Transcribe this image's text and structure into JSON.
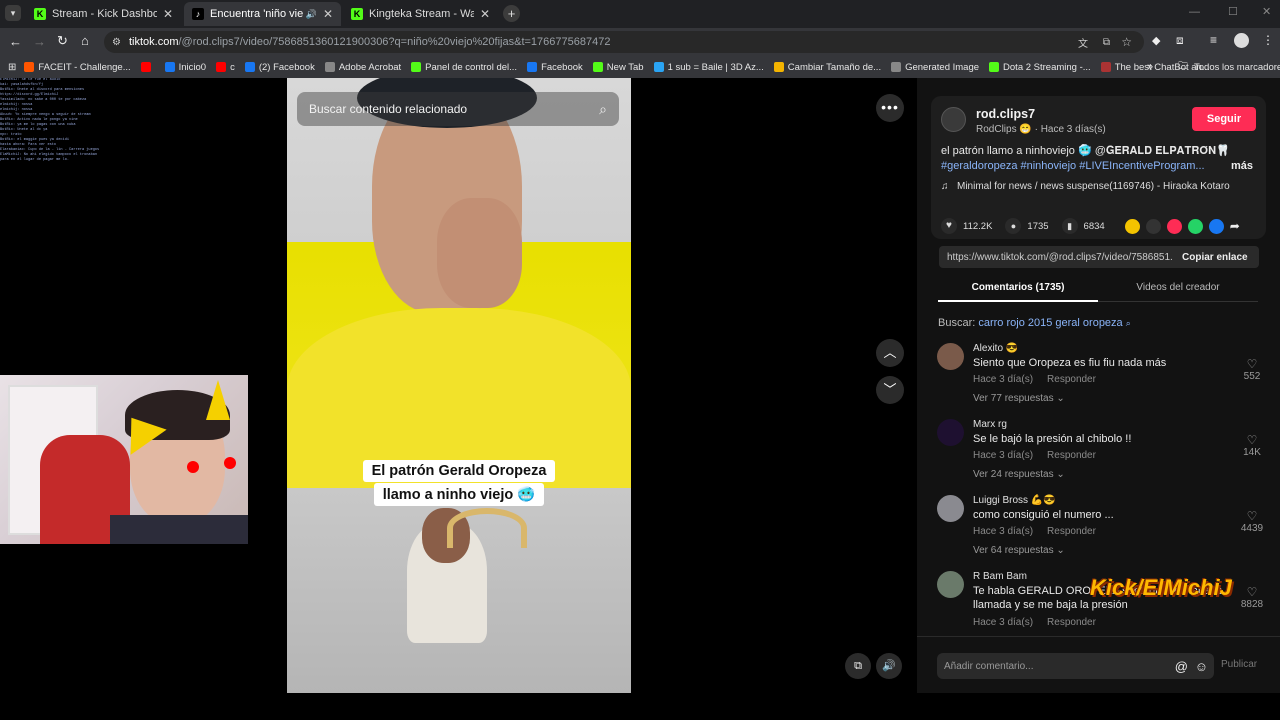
{
  "tabs": [
    {
      "title": "Stream - Kick Dashboard",
      "favicon": "kick-icon"
    },
    {
      "title": "Encuentra 'niño viejo fijas'",
      "favicon": "tiktok-icon",
      "active": true
    },
    {
      "title": "Kingteka Stream - Watch Live o",
      "favicon": "kick-icon"
    }
  ],
  "toolbar": {
    "url_host": "tiktok.com",
    "url_path": "/@rod.clips7/video/7586851360121900306?q=niño%20viejo%20fijas&t=1766775687472"
  },
  "bookmarks": [
    {
      "label": "FACEIT - Challenge...",
      "color": "#ff5500"
    },
    {
      "label": "",
      "color": "#ff0000"
    },
    {
      "label": "Inicio0",
      "color": "#1877f2"
    },
    {
      "label": "c",
      "color": "#ff0000"
    },
    {
      "label": "(2) Facebook",
      "color": "#1877f2"
    },
    {
      "label": "Adobe Acrobat",
      "color": "#888888"
    },
    {
      "label": "Panel de control del...",
      "color": "#53fc18"
    },
    {
      "label": "Facebook",
      "color": "#1877f2"
    },
    {
      "label": "New Tab",
      "color": "#53fc18"
    },
    {
      "label": "1 sub = Baile | 3D Az...",
      "color": "#2aa4f4"
    },
    {
      "label": "Cambiar Tamaño de...",
      "color": "#f4b400"
    },
    {
      "label": "Generated Image",
      "color": "#888888"
    },
    {
      "label": "Dota 2 Streaming -...",
      "color": "#53fc18"
    },
    {
      "label": "The best ChatBot an...",
      "color": "#aa3333"
    }
  ],
  "bookmarks_more": "»",
  "all_bookmarks": "Todos los marcadores",
  "video": {
    "search_placeholder": "Buscar contenido relacionado",
    "caption_line1": "El patrón Gerald Oropeza",
    "caption_line2": "llamo a ninho viejo 🥶"
  },
  "stream_watermark": "Kick/ElMichiJ",
  "chat_overlay": [
    "ElMichiJ: Se te fue el audio",
    "kai: yasalahdsfkn/fj",
    "BotRix: Únete al discord para mensiones",
    "https://discord.gg/ElmichiJ",
    "Yassimilado: no sabe a 000 te por cabeza",
    "elmichij: nossa",
    "elmichij: nossa",
    "Akuuh: Yo siempre vengo a seguir de stream",
    "BotRix: Activo nada le pongo ya vine",
    "BotRix: ya me lo pagas con una cuba",
    "BotRix: Unete al dc ya",
    "npc: trato",
    "BotRix: el maggie pues ya decidi",
    "hasta ahora: Para ver esto",
    "Elarabaniac: Cupo de la - lin - Carrera juegos",
    "ElaMichiJ: No ahi elegido tampoco el tronaban",
    "para en el lugar de pagar me lo."
  ],
  "author": {
    "username": "rod.clips7",
    "display": "RodClips 😁 · Hace 3 días(s)",
    "follow": "Seguir"
  },
  "description": {
    "line1": "el patrón llamo a ninhoviejo 🥶 @𝐆𝐄𝐑𝐀𝐋𝐃 𝐄𝐋𝐏𝐀𝐓𝐑𝐎́𝐍🦷",
    "line2": "#geraldoropeza #ninhoviejo #LIVEIncentiveProgram...",
    "more": "más",
    "music": "Minimal for news / news suspense(1169746) - Hiraoka Kotaro"
  },
  "stats": {
    "likes": "112.2K",
    "comments": "1735",
    "saves": "6834"
  },
  "link": {
    "url": "https://www.tiktok.com/@rod.clips7/video/7586851...",
    "copy": "Copiar enlace"
  },
  "panel_tabs": {
    "comments": "Comentarios (1735)",
    "creator_videos": "Videos del creador"
  },
  "search": {
    "prefix": "Buscar:",
    "query": "carro rojo 2015 geral oropeza"
  },
  "comments": [
    {
      "name": "Alexito 😎",
      "text": "Siento que Oropeza es fiu fiu nada más",
      "meta": "Hace 3 día(s)",
      "reply": "Responder",
      "replies": "Ver 77 respuestas",
      "likes": "552",
      "avatar": "#7a5a4a"
    },
    {
      "name": "Marx rg",
      "text": "Se le bajó la presión al chibolo !!",
      "meta": "Hace 3 día(s)",
      "reply": "Responder",
      "replies": "Ver 24 respuestas",
      "likes": "14K",
      "avatar": "#1e1030"
    },
    {
      "name": "Luiggi Bross 💪😎",
      "text": "como consiguió el numero ...",
      "meta": "Hace 3 día(s)",
      "reply": "Responder",
      "replies": "Ver 64 respuestas",
      "likes": "4439",
      "avatar": "#8a8a90"
    },
    {
      "name": "R Bam Bam",
      "text": "Te habla GERALD OROPEZA sentí que me falta tu llamada y se me baja la presión",
      "meta": "Hace 3 día(s)",
      "reply": "Responder",
      "replies": "",
      "likes": "8828",
      "avatar": "#6a7a6a"
    }
  ],
  "comment_input": {
    "placeholder": "Añadir comentario...",
    "post": "Publicar"
  },
  "colors": {
    "follow": "#fe2c55",
    "accent": "#fe2c55",
    "link": "#8ab4f8",
    "kick": "#53fc18"
  }
}
